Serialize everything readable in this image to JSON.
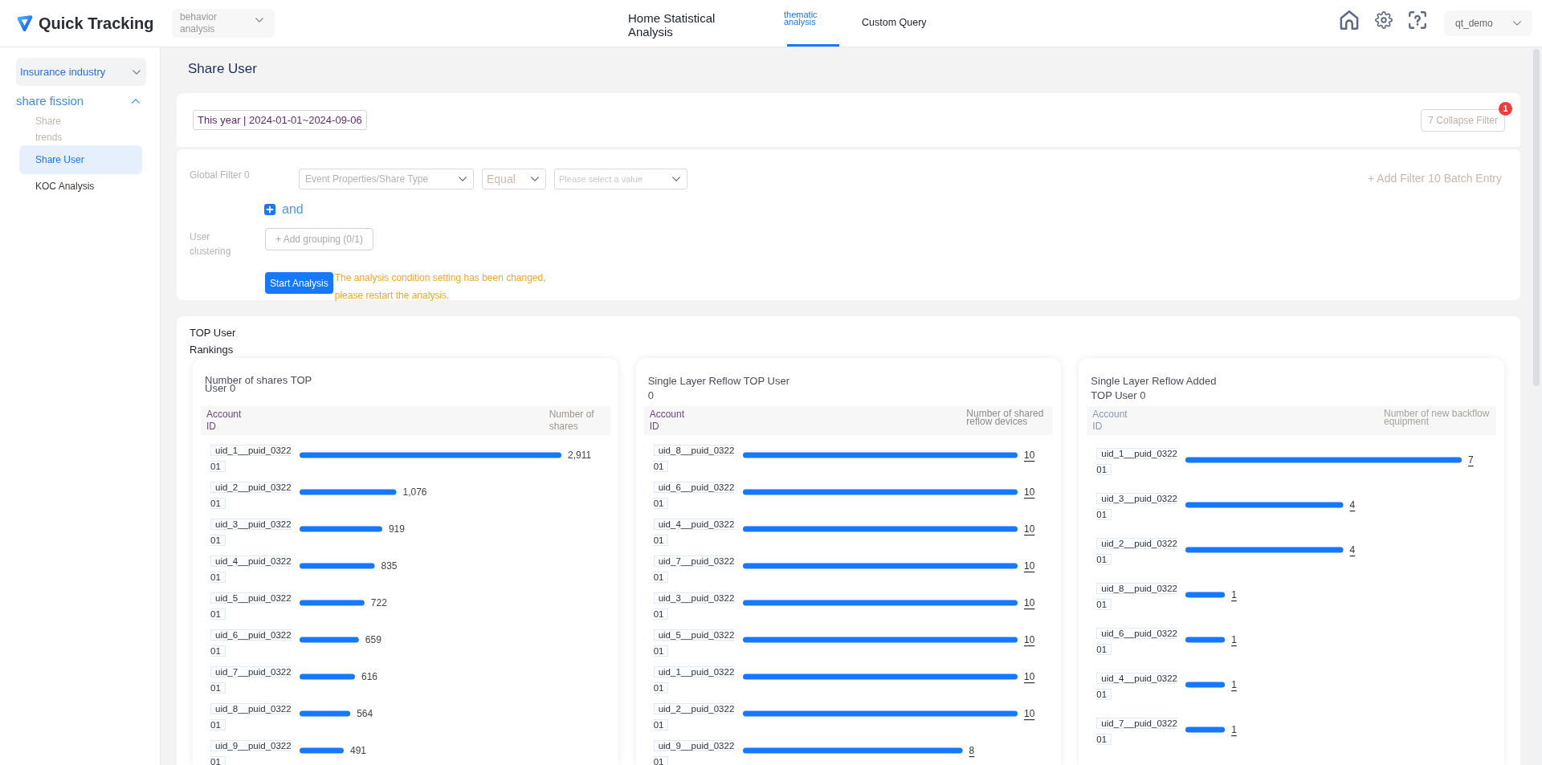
{
  "header": {
    "logo": "Quick Tracking",
    "module_select": {
      "value": "behavior analysis"
    },
    "nav_tabs": [
      {
        "label": "Home Statistical Analysis",
        "selected": false
      },
      {
        "label": "thematic analysis",
        "selected": true
      },
      {
        "label": "Custom Query",
        "selected": false
      }
    ],
    "user_menu": {
      "value": "qt_demo"
    }
  },
  "sidebar": {
    "industry_select": {
      "value": "Insurance industry"
    },
    "groups": [
      {
        "label": "share fission",
        "expanded": true,
        "children": [
          {
            "label": "Share trends",
            "selected": false,
            "disabled": true
          },
          {
            "label": "Share User",
            "selected": true,
            "disabled": false
          },
          {
            "label": "KOC Analysis",
            "selected": false,
            "disabled": false
          }
        ]
      }
    ]
  },
  "page_title": "Share User",
  "date_filter": {
    "value": "This year | 2024-01-01~2024-09-06"
  },
  "collapse_filter": {
    "label": "7 Collapse Filter",
    "badge": "1"
  },
  "global_filter": {
    "label": "Global Filter 0",
    "conditions": [
      {
        "property": "Event Properties/Share Type",
        "operator": "Equal",
        "placeholder": "Please select a value"
      }
    ],
    "and_label": "and",
    "add_filter": "+ Add Filter 10 Batch Entry"
  },
  "user_clustering": {
    "label": "User clustering",
    "add_grouping": "+ Add grouping (0/1)"
  },
  "start_analysis": {
    "label": "Start Analysis",
    "warning": "The analysis condition setting has been changed, please restart the analysis."
  },
  "rankings": {
    "title": "TOP User Rankings",
    "cards": [
      {
        "title": "Number of shares TOP User 0",
        "kind": "plain",
        "columns": [
          "Account ID",
          "Number of shares"
        ],
        "chart_data": {
          "type": "bar",
          "orientation": "horizontal",
          "categories": [
            "uid_1__puid_032201",
            "uid_2__puid_032201",
            "uid_3__puid_032201",
            "uid_4__puid_032201",
            "uid_5__puid_032201",
            "uid_6__puid_032201",
            "uid_7__puid_032201",
            "uid_8__puid_032201",
            "uid_9__puid_032201"
          ],
          "values": [
            2911,
            1076,
            919,
            835,
            722,
            659,
            616,
            564,
            491
          ],
          "value_labels": [
            "2,911",
            "1,076",
            "919",
            "835",
            "722",
            "659",
            "616",
            "564",
            "491"
          ]
        }
      },
      {
        "title": "Single Layer Reflow TOP User 0",
        "kind": "link",
        "columns": [
          "Account ID",
          "Number of shared reflow devices"
        ],
        "chart_data": {
          "type": "bar",
          "orientation": "horizontal",
          "categories": [
            "uid_8__puid_032201",
            "uid_6__puid_032201",
            "uid_4__puid_032201",
            "uid_7__puid_032201",
            "uid_3__puid_032201",
            "uid_5__puid_032201",
            "uid_1__puid_032201",
            "uid_2__puid_032201",
            "uid_9__puid_032201"
          ],
          "values": [
            10,
            10,
            10,
            10,
            10,
            10,
            10,
            10,
            8
          ],
          "value_labels": [
            "10",
            "10",
            "10",
            "10",
            "10",
            "10",
            "10",
            "10",
            "8"
          ]
        }
      },
      {
        "title": "Single Layer Reflow Added TOP User 0",
        "kind": "link",
        "columns": [
          "Account ID",
          "Number of new backflow equipment"
        ],
        "chart_data": {
          "type": "bar",
          "orientation": "horizontal",
          "categories": [
            "uid_1__puid_032201",
            "uid_3__puid_032201",
            "uid_2__puid_032201",
            "uid_8__puid_032201",
            "uid_6__puid_032201",
            "uid_4__puid_032201",
            "uid_7__puid_032201"
          ],
          "values": [
            7,
            4,
            4,
            1,
            1,
            1,
            1
          ],
          "value_labels": [
            "7",
            "4",
            "4",
            "1",
            "1",
            "1",
            "1"
          ]
        }
      }
    ]
  }
}
